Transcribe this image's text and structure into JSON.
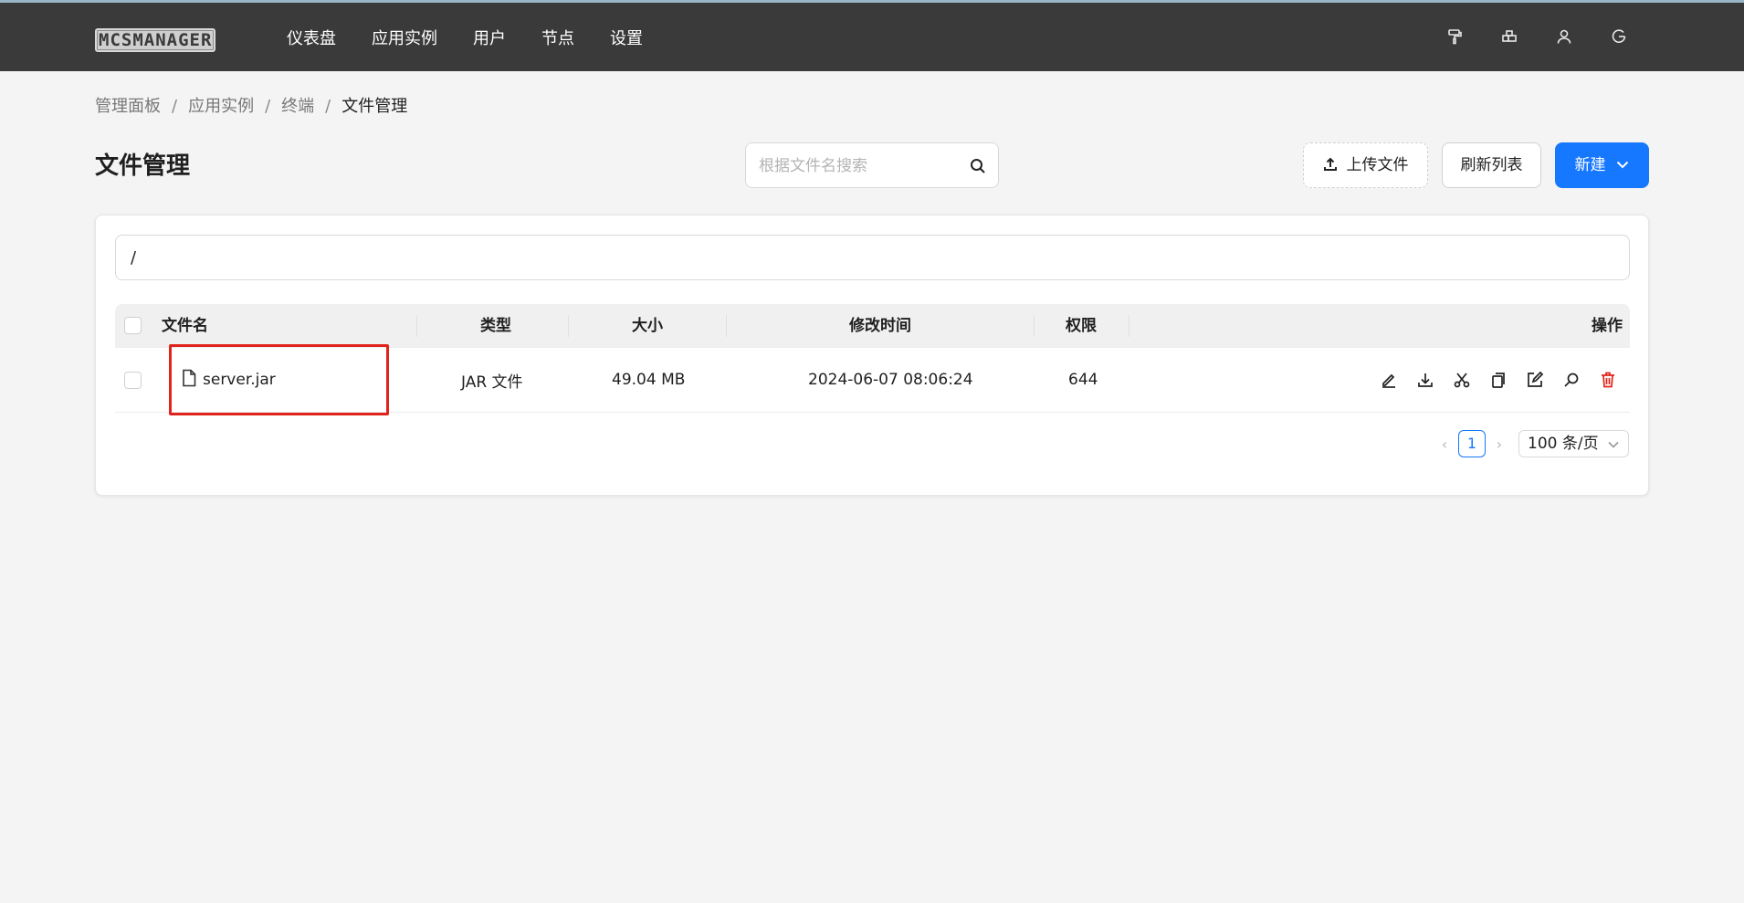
{
  "header": {
    "logo_text": "MCSMANAGER",
    "nav": [
      "仪表盘",
      "应用实例",
      "用户",
      "节点",
      "设置"
    ],
    "icons": [
      "paint-roller-icon",
      "layout-icon",
      "user-icon",
      "logout-icon"
    ]
  },
  "breadcrumb": [
    "管理面板",
    "应用实例",
    "终端",
    "文件管理"
  ],
  "page_title": "文件管理",
  "search": {
    "placeholder": "根据文件名搜索",
    "value": ""
  },
  "toolbar": {
    "upload_label": "上传文件",
    "refresh_label": "刷新列表",
    "new_label": "新建"
  },
  "path": "/",
  "table": {
    "columns": [
      "文件名",
      "类型",
      "大小",
      "修改时间",
      "权限",
      "操作"
    ],
    "rows": [
      {
        "name": "server.jar",
        "type": "JAR 文件",
        "size": "49.04 MB",
        "modified": "2024-06-07 08:06:24",
        "permission": "644",
        "actions": [
          "rename-icon",
          "download-icon",
          "cut-icon",
          "copy-icon",
          "edit-icon",
          "search-icon",
          "delete-icon"
        ]
      }
    ]
  },
  "pagination": {
    "current": "1",
    "page_size": "100 条/页"
  },
  "colors": {
    "header_bg": "#3a3a3a",
    "primary": "#1677ff",
    "danger": "#e0241b",
    "highlight": "#e0241b"
  }
}
